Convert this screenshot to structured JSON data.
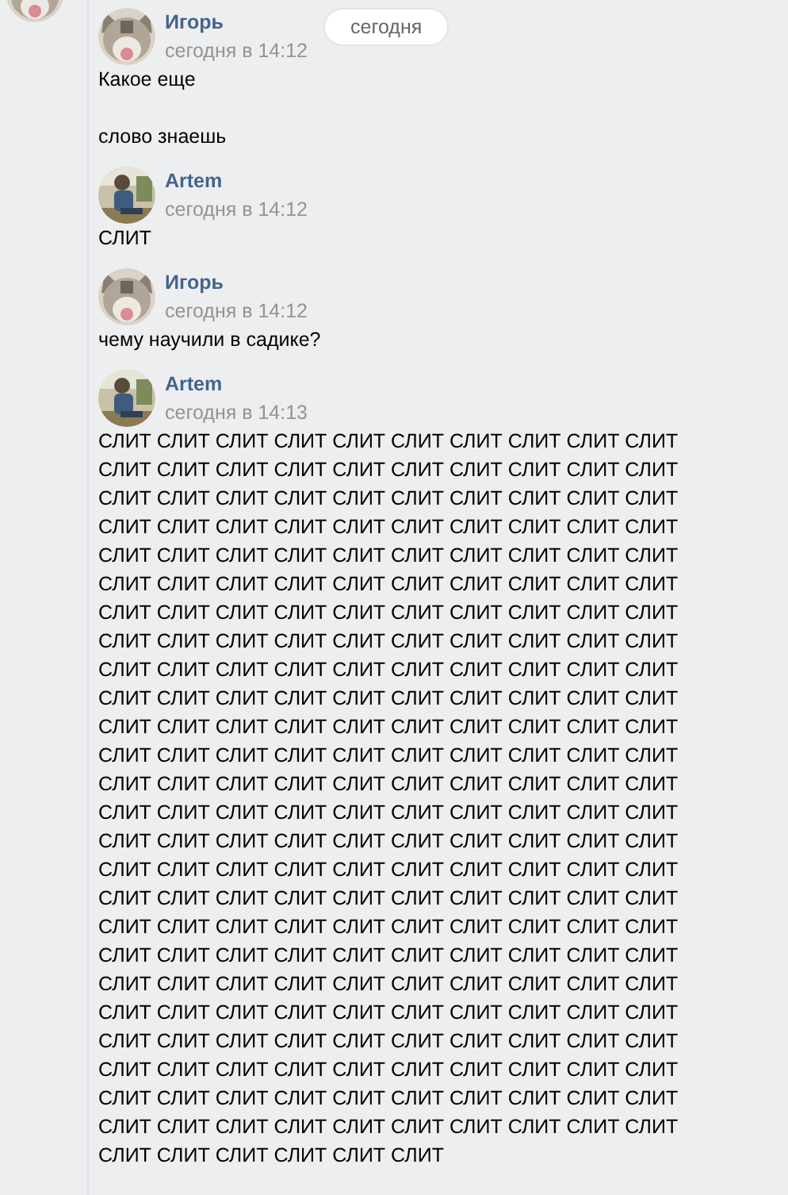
{
  "date_badge": "сегодня",
  "messages": [
    {
      "author": "Игорь",
      "time": "сегодня в 14:12",
      "text": "Какое еще\n\nслово знаешь"
    },
    {
      "author": "Artem",
      "time": "сегодня в 14:12",
      "text": "СЛИТ"
    },
    {
      "author": "Игорь",
      "time": "сегодня в 14:12",
      "text": "чему научили в садике?"
    },
    {
      "author": "Artem",
      "time": "сегодня в 14:13",
      "text": "СЛИТ СЛИТ СЛИТ СЛИТ СЛИТ СЛИТ СЛИТ СЛИТ СЛИТ СЛИТ\nСЛИТ СЛИТ СЛИТ СЛИТ СЛИТ СЛИТ СЛИТ СЛИТ СЛИТ СЛИТ\nСЛИТ СЛИТ СЛИТ СЛИТ СЛИТ СЛИТ СЛИТ СЛИТ СЛИТ СЛИТ\nСЛИТ СЛИТ СЛИТ СЛИТ СЛИТ СЛИТ СЛИТ СЛИТ СЛИТ СЛИТ\nСЛИТ СЛИТ СЛИТ СЛИТ СЛИТ СЛИТ СЛИТ СЛИТ СЛИТ СЛИТ\nСЛИТ СЛИТ СЛИТ СЛИТ СЛИТ СЛИТ СЛИТ СЛИТ СЛИТ СЛИТ\nСЛИТ СЛИТ СЛИТ СЛИТ СЛИТ СЛИТ СЛИТ СЛИТ СЛИТ СЛИТ\nСЛИТ СЛИТ СЛИТ СЛИТ СЛИТ СЛИТ СЛИТ СЛИТ СЛИТ СЛИТ\nСЛИТ СЛИТ СЛИТ СЛИТ СЛИТ СЛИТ СЛИТ СЛИТ СЛИТ СЛИТ\nСЛИТ СЛИТ СЛИТ СЛИТ СЛИТ СЛИТ СЛИТ СЛИТ СЛИТ СЛИТ\nСЛИТ СЛИТ СЛИТ СЛИТ СЛИТ СЛИТ СЛИТ СЛИТ СЛИТ СЛИТ\nСЛИТ СЛИТ СЛИТ СЛИТ СЛИТ СЛИТ СЛИТ СЛИТ СЛИТ СЛИТ\nСЛИТ СЛИТ СЛИТ СЛИТ СЛИТ СЛИТ СЛИТ СЛИТ СЛИТ СЛИТ\nСЛИТ СЛИТ СЛИТ СЛИТ СЛИТ СЛИТ СЛИТ СЛИТ СЛИТ СЛИТ\nСЛИТ СЛИТ СЛИТ СЛИТ СЛИТ СЛИТ СЛИТ СЛИТ СЛИТ СЛИТ\nСЛИТ СЛИТ СЛИТ СЛИТ СЛИТ СЛИТ СЛИТ СЛИТ СЛИТ СЛИТ\nСЛИТ СЛИТ СЛИТ СЛИТ СЛИТ СЛИТ СЛИТ СЛИТ СЛИТ СЛИТ\nСЛИТ СЛИТ СЛИТ СЛИТ СЛИТ СЛИТ СЛИТ СЛИТ СЛИТ СЛИТ\nСЛИТ СЛИТ СЛИТ СЛИТ СЛИТ СЛИТ СЛИТ СЛИТ СЛИТ СЛИТ\nСЛИТ СЛИТ СЛИТ СЛИТ СЛИТ СЛИТ СЛИТ СЛИТ СЛИТ СЛИТ\nСЛИТ СЛИТ СЛИТ СЛИТ СЛИТ СЛИТ СЛИТ СЛИТ СЛИТ СЛИТ\nСЛИТ СЛИТ СЛИТ СЛИТ СЛИТ СЛИТ СЛИТ СЛИТ СЛИТ СЛИТ\nСЛИТ СЛИТ СЛИТ СЛИТ СЛИТ СЛИТ СЛИТ СЛИТ СЛИТ СЛИТ\nСЛИТ СЛИТ СЛИТ СЛИТ СЛИТ СЛИТ СЛИТ СЛИТ СЛИТ СЛИТ\nСЛИТ СЛИТ СЛИТ СЛИТ СЛИТ СЛИТ СЛИТ СЛИТ СЛИТ СЛИТ\nСЛИТ СЛИТ СЛИТ СЛИТ СЛИТ СЛИТ"
    }
  ]
}
